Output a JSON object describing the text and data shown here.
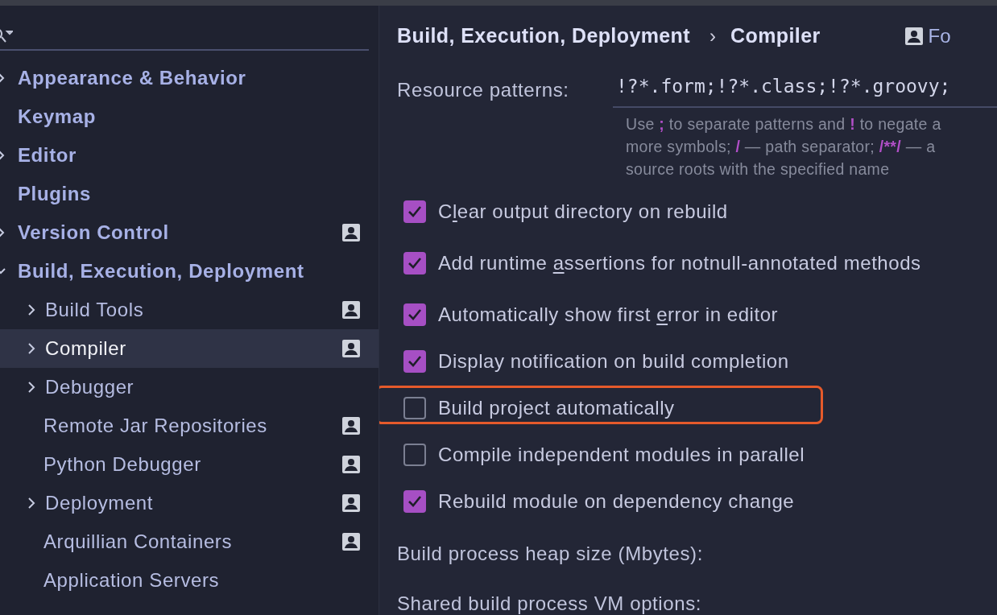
{
  "sidebar": {
    "items": [
      {
        "label": "Appearance & Behavior",
        "expanded": false,
        "selected": false,
        "scope_icon": false
      },
      {
        "label": "Keymap",
        "selected": false,
        "scope_icon": false
      },
      {
        "label": "Editor",
        "expanded": false,
        "selected": false,
        "scope_icon": false
      },
      {
        "label": "Plugins",
        "selected": false,
        "scope_icon": false
      },
      {
        "label": "Version Control",
        "expanded": false,
        "selected": false,
        "scope_icon": true
      },
      {
        "label": "Build, Execution, Deployment",
        "expanded": true,
        "selected": false,
        "scope_icon": false,
        "children": [
          {
            "label": "Build Tools",
            "expanded": false,
            "selected": false,
            "scope_icon": true
          },
          {
            "label": "Compiler",
            "expanded": false,
            "selected": true,
            "scope_icon": true
          },
          {
            "label": "Debugger",
            "expanded": false,
            "selected": false,
            "scope_icon": false
          },
          {
            "label": "Remote Jar Repositories",
            "selected": false,
            "scope_icon": true
          },
          {
            "label": "Python Debugger",
            "selected": false,
            "scope_icon": true
          },
          {
            "label": "Deployment",
            "expanded": false,
            "selected": false,
            "scope_icon": true
          },
          {
            "label": "Arquillian Containers",
            "selected": false,
            "scope_icon": true
          },
          {
            "label": "Application Servers",
            "selected": false,
            "scope_icon": false
          }
        ]
      }
    ]
  },
  "breadcrumb": {
    "parent": "Build, Execution, Deployment",
    "separator": "›",
    "current": "Compiler",
    "scope_link": "Fo"
  },
  "resource_patterns": {
    "label": "Resource patterns:",
    "value": "!?*.form;!?*.class;!?*.groovy;",
    "hint_lines": [
      [
        {
          "kind": "plain",
          "text": "Use "
        },
        {
          "kind": "symbol",
          "text": ";"
        },
        {
          "kind": "plain",
          "text": " to separate patterns and "
        },
        {
          "kind": "symbol",
          "text": "!"
        },
        {
          "kind": "plain",
          "text": " to negate a"
        }
      ],
      [
        {
          "kind": "plain",
          "text": "more symbols; "
        },
        {
          "kind": "symbol",
          "text": "/"
        },
        {
          "kind": "plain",
          "text": " — path separator; "
        },
        {
          "kind": "symbol",
          "text": "/**/"
        },
        {
          "kind": "plain",
          "text": " — a"
        }
      ],
      [
        {
          "kind": "plain",
          "text": "source roots with the specified name"
        }
      ]
    ]
  },
  "options": [
    {
      "checked": true,
      "highlighted": false,
      "label": [
        {
          "kind": "plain",
          "text": "C"
        },
        {
          "kind": "mnemonic",
          "text": "l"
        },
        {
          "kind": "plain",
          "text": "ear output directory on rebuild"
        }
      ]
    },
    {
      "checked": true,
      "highlighted": false,
      "label": [
        {
          "kind": "plain",
          "text": "Add runtime "
        },
        {
          "kind": "mnemonic",
          "text": "a"
        },
        {
          "kind": "plain",
          "text": "ssertions for notnull-annotated methods"
        }
      ]
    },
    {
      "checked": true,
      "highlighted": false,
      "label": [
        {
          "kind": "plain",
          "text": "Automatically show first "
        },
        {
          "kind": "mnemonic",
          "text": "e"
        },
        {
          "kind": "plain",
          "text": "rror in editor"
        }
      ]
    },
    {
      "checked": true,
      "highlighted": false,
      "label": [
        {
          "kind": "plain",
          "text": "Display notification on build completion"
        }
      ]
    },
    {
      "checked": false,
      "highlighted": true,
      "label": [
        {
          "kind": "plain",
          "text": "Build project automatically"
        }
      ]
    },
    {
      "checked": false,
      "highlighted": false,
      "label": [
        {
          "kind": "plain",
          "text": "Compile independent modules in parallel"
        }
      ]
    },
    {
      "checked": true,
      "highlighted": false,
      "label": [
        {
          "kind": "plain",
          "text": "Rebuild module on dependency change"
        }
      ]
    }
  ],
  "fields": [
    {
      "label": "Build process heap size (Mbytes):"
    },
    {
      "label": "Shared build process VM options:"
    }
  ]
}
